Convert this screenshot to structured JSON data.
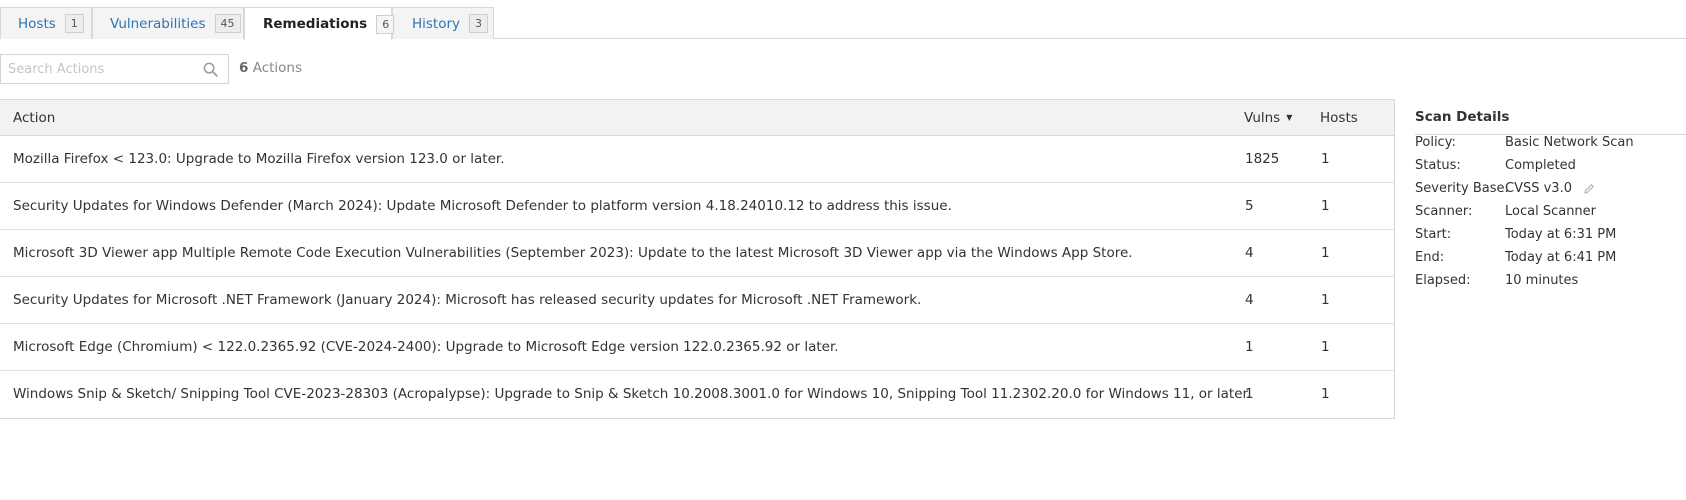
{
  "tabs": [
    {
      "label": "Hosts",
      "count": "1"
    },
    {
      "label": "Vulnerabilities",
      "count": "45"
    },
    {
      "label": "Remediations",
      "count": "6",
      "active": true
    },
    {
      "label": "History",
      "count": "3"
    }
  ],
  "search": {
    "placeholder": "Search Actions",
    "value": "",
    "icon": "search-icon"
  },
  "actions_count": {
    "number": "6",
    "label": "Actions"
  },
  "table": {
    "headers": {
      "action": "Action",
      "vulns": "Vulns",
      "hosts": "Hosts"
    },
    "rows": [
      {
        "action": "Mozilla Firefox < 123.0: Upgrade to Mozilla Firefox version 123.0 or later.",
        "vulns": "1825",
        "hosts": "1"
      },
      {
        "action": "Security Updates for Windows Defender (March 2024): Update Microsoft Defender to platform version 4.18.24010.12 to address this issue.",
        "vulns": "5",
        "hosts": "1"
      },
      {
        "action": "Microsoft 3D Viewer app Multiple Remote Code Execution Vulnerabilities (September 2023): Update to the latest Microsoft 3D Viewer app via the Windows App Store.",
        "vulns": "4",
        "hosts": "1"
      },
      {
        "action": "Security Updates for Microsoft .NET Framework (January 2024): Microsoft has released security updates for Microsoft .NET Framework.",
        "vulns": "4",
        "hosts": "1"
      },
      {
        "action": "Microsoft Edge (Chromium) < 122.0.2365.92 (CVE-2024-2400): Upgrade to Microsoft Edge version 122.0.2365.92 or later.",
        "vulns": "1",
        "hosts": "1"
      },
      {
        "action": "Windows Snip & Sketch/ Snipping Tool CVE-2023-28303 (Acropalypse): Upgrade to Snip & Sketch 10.2008.3001.0 for Windows 10, Snipping Tool 11.2302.20.0 for Windows 11, or later.",
        "vulns": "1",
        "hosts": "1"
      }
    ]
  },
  "scan_details": {
    "title": "Scan Details",
    "items": [
      {
        "label": "Policy:",
        "value": "Basic Network Scan"
      },
      {
        "label": "Status:",
        "value": "Completed"
      },
      {
        "label": "Severity Base:",
        "value": "CVSS v3.0",
        "editable": true
      },
      {
        "label": "Scanner:",
        "value": "Local Scanner"
      },
      {
        "label": "Start:",
        "value": "Today at 6:31 PM"
      },
      {
        "label": "End:",
        "value": "Today at 6:41 PM"
      },
      {
        "label": "Elapsed:",
        "value": "10 minutes"
      }
    ]
  },
  "colors": {
    "link": "#2e74b5",
    "border": "#d8d8d8",
    "header_bg": "#f2f2f2"
  }
}
